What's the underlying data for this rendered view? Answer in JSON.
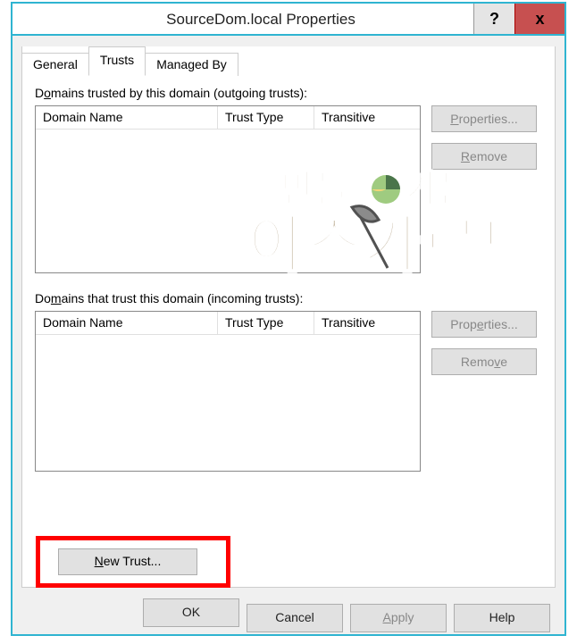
{
  "window": {
    "title": "SourceDom.local Properties",
    "help_glyph": "?",
    "close_glyph": "x"
  },
  "tabs": {
    "general": "General",
    "trusts": "Trusts",
    "managed_by": "Managed By"
  },
  "outgoing": {
    "label_pre": "D",
    "label_u": "o",
    "label_post": "mains trusted by this domain (outgoing trusts):",
    "col1": "Domain Name",
    "col2": "Trust Type",
    "col3": "Transitive",
    "properties_pre": "",
    "properties_u": "P",
    "properties_post": "roperties...",
    "remove_pre": "",
    "remove_u": "R",
    "remove_post": "emove"
  },
  "incoming": {
    "label_pre": "Do",
    "label_u": "m",
    "label_post": "ains that trust this domain (incoming trusts):",
    "col1": "Domain Name",
    "col2": "Trust Type",
    "col3": "Transitive",
    "properties_pre": "Prop",
    "properties_u": "e",
    "properties_post": "rties...",
    "remove_pre": "Remo",
    "remove_u": "v",
    "remove_post": "e"
  },
  "new_trust": {
    "pre": "",
    "u": "N",
    "post": "ew Trust..."
  },
  "buttons": {
    "ok": "OK",
    "cancel": "Cancel",
    "apply_pre": "",
    "apply_u": "A",
    "apply_post": "pply",
    "help": "Help"
  }
}
